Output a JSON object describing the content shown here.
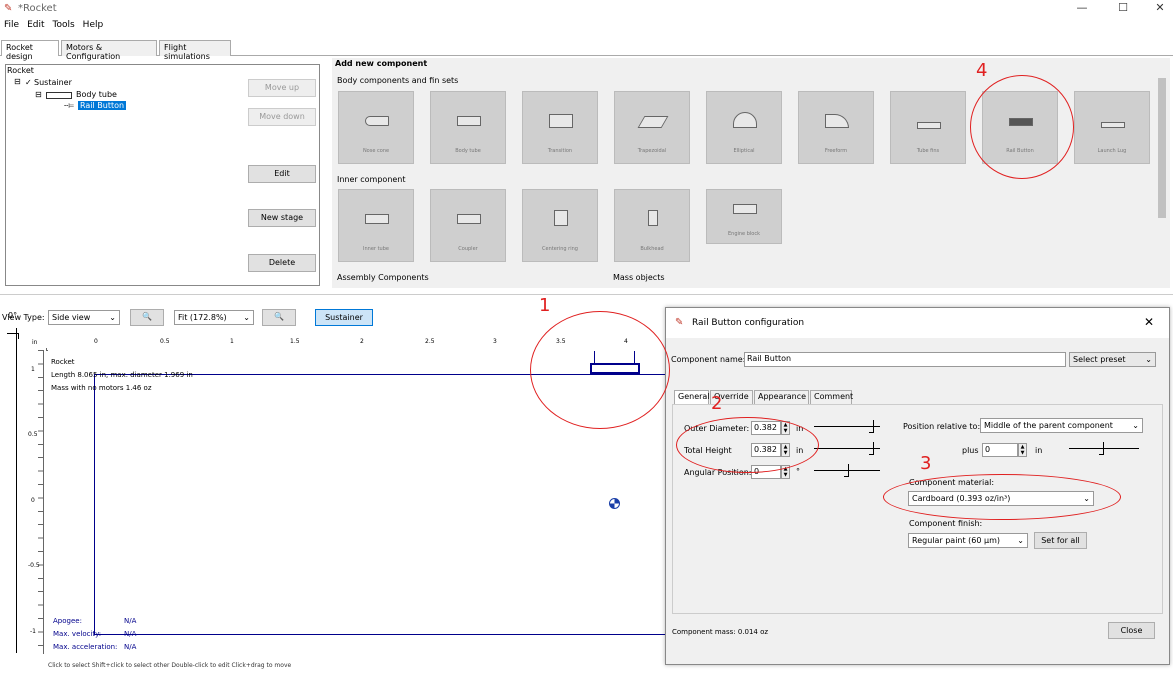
{
  "window": {
    "title": "*Rocket",
    "minimize": "—",
    "maximize": "☐",
    "close": "✕"
  },
  "menu": [
    "File",
    "Edit",
    "Tools",
    "Help"
  ],
  "main_tabs": [
    "Rocket design",
    "Motors & Configuration",
    "Flight simulations"
  ],
  "tree": {
    "root": "Rocket",
    "stage": "Sustainer",
    "body": "Body tube",
    "selected": "Rail Button"
  },
  "tree_buttons": {
    "move_up": "Move up",
    "move_down": "Move down",
    "edit": "Edit",
    "new_stage": "New stage",
    "delete": "Delete"
  },
  "add_component": {
    "heading": "Add new component",
    "body_section": "Body components and fin sets",
    "body_items": [
      "Nose cone",
      "Body tube",
      "Transition",
      "Trapezoidal",
      "Elliptical",
      "Freeform",
      "Tube fins",
      "Rail Button",
      "Launch Lug"
    ],
    "inner_section": "Inner component",
    "inner_items": [
      "Inner tube",
      "Coupler",
      "Centering ring",
      "Bulkhead",
      "Engine block"
    ],
    "assembly_section": "Assembly Components",
    "mass_section": "Mass objects"
  },
  "view_toolbar": {
    "view_type_label": "View Type:",
    "view_type_value": "Side view",
    "zoom_value": "Fit (172.8%)",
    "stage_button": "Sustainer",
    "angle_label": "0°",
    "unit": "in"
  },
  "ruler_ticks": [
    "0",
    "0.5",
    "1",
    "1.5",
    "2",
    "2.5",
    "3",
    "3.5",
    "4"
  ],
  "ruler_left_ticks": [
    "1",
    "0.5",
    "0",
    "-0.5",
    "-1"
  ],
  "rocket_info": {
    "name": "Rocket",
    "length": "Length 8.065 in, max. diameter 1.969 in",
    "mass": "Mass with no motors 1.46 oz"
  },
  "flight_info": {
    "apogee_label": "Apogee:",
    "apogee_value": "N/A",
    "velocity_label": "Max. velocity:",
    "velocity_value": "N/A",
    "accel_label": "Max. acceleration:",
    "accel_value": "N/A"
  },
  "status_bar": "Click to select    Shift+click to select other    Double-click to edit    Click+drag to move",
  "dialog": {
    "title": "Rail Button configuration",
    "component_name_label": "Component name:",
    "component_name_value": "Rail Button",
    "select_preset": "Select preset",
    "tabs": [
      "General",
      "Override",
      "Appearance",
      "Comment"
    ],
    "outer_diameter_label": "Outer Diameter:",
    "outer_diameter_value": "0.382",
    "total_height_label": "Total Height",
    "total_height_value": "0.382",
    "unit_in": "in",
    "angular_position_label": "Angular Position:",
    "angular_position_value": "0",
    "degree": "°",
    "position_relative_label": "Position relative to:",
    "position_relative_value": "Middle of the parent component",
    "plus_label": "plus",
    "plus_value": "0",
    "material_label": "Component material:",
    "material_value": "Cardboard (0.393 oz/in³)",
    "finish_label": "Component finish:",
    "finish_value": "Regular paint (60 µm)",
    "set_for_all": "Set for all",
    "mass_text": "Component mass: 0.014 oz",
    "close_button": "Close"
  },
  "annotations": [
    "1",
    "2",
    "3",
    "4"
  ],
  "colors": {
    "annotation": "#e02020",
    "selection": "#0078d7",
    "rocket_outline": "#00008b"
  }
}
